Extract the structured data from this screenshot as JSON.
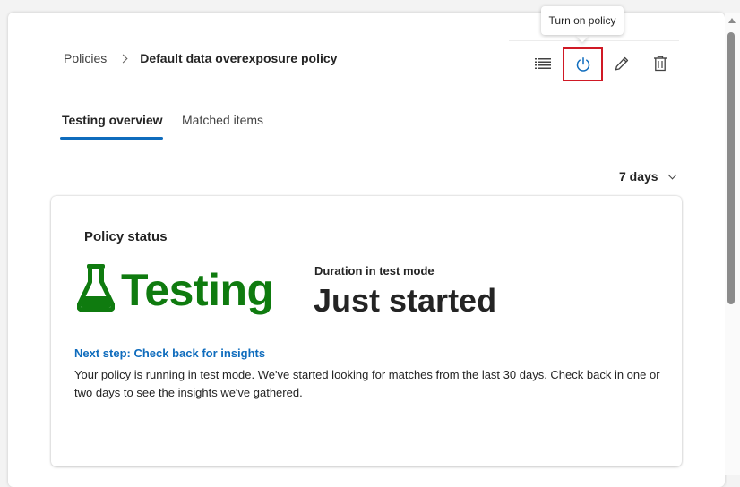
{
  "breadcrumb": {
    "parent": "Policies",
    "current": "Default data overexposure policy"
  },
  "toolbar": {
    "tooltip": "Turn on policy",
    "buttons": [
      {
        "icon": "list-icon"
      },
      {
        "icon": "power-icon"
      },
      {
        "icon": "edit-icon"
      },
      {
        "icon": "delete-icon"
      }
    ]
  },
  "tabs": [
    {
      "label": "Testing overview",
      "active": true
    },
    {
      "label": "Matched items",
      "active": false
    }
  ],
  "time_range": {
    "selected": "7 days"
  },
  "card": {
    "heading": "Policy status",
    "status": "Testing",
    "duration_label": "Duration in test mode",
    "duration_value": "Just started",
    "next_step": "Next step: Check back for insights",
    "description": "Your policy is running in test mode. We've started looking for matches from the last 30 days. Check back in one or two days to see the insights we've gathered."
  },
  "colors": {
    "accent": "#0f6cbd",
    "status_green": "#0f7b0f",
    "highlight_red": "#d01925"
  }
}
